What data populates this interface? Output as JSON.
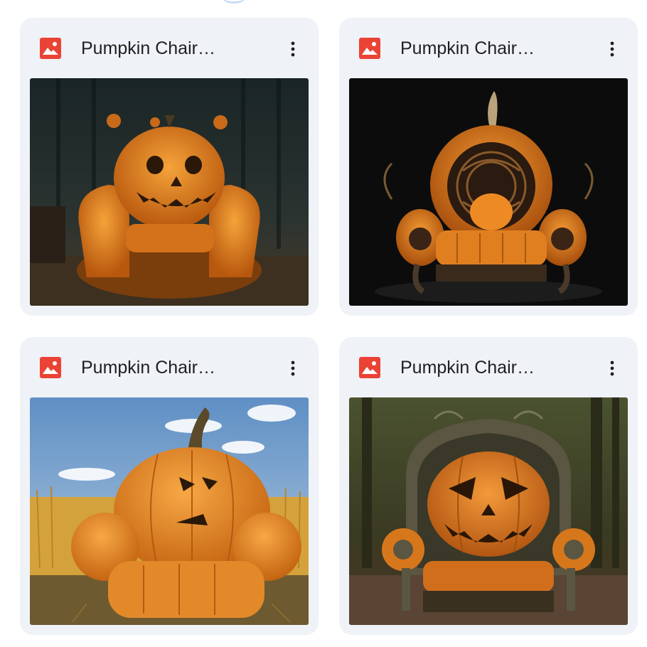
{
  "files": [
    {
      "name": "Pumpkin Chair…",
      "icon": "image-file-icon",
      "thumbnail": "jack-o-lantern-armchair-in-dark-barn"
    },
    {
      "name": "Pumpkin Chair…",
      "icon": "image-file-icon",
      "thumbnail": "ornate-pumpkin-throne-on-black"
    },
    {
      "name": "Pumpkin Chair…",
      "icon": "image-file-icon",
      "thumbnail": "pumpkin-armchair-in-wheat-field"
    },
    {
      "name": "Pumpkin Chair…",
      "icon": "image-file-icon",
      "thumbnail": "jack-o-lantern-throne-in-forest"
    }
  ],
  "colors": {
    "card_bg": "#eff2f7",
    "file_icon_red": "#ea4335",
    "text": "#1f1f1f",
    "pumpkin": "#e8851c"
  }
}
